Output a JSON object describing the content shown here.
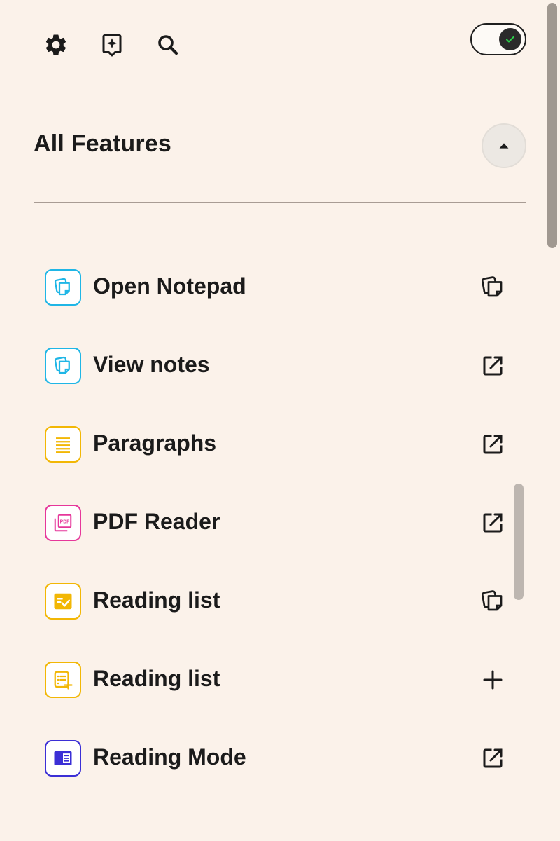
{
  "topbar": {
    "settings": "gear-icon",
    "ai_assistant": "sparkle-note-icon",
    "search": "search-icon",
    "toggle_on": true
  },
  "section": {
    "title": "All Features",
    "collapsed": false
  },
  "items": [
    {
      "label": "Open Notepad",
      "icon": "notepad-icon",
      "color": "#1FB6E6",
      "action": "copy-note-icon"
    },
    {
      "label": "View notes",
      "icon": "notepad-icon",
      "color": "#1FB6E6",
      "action": "external-link-icon"
    },
    {
      "label": "Paragraphs",
      "icon": "paragraph-lines-icon",
      "color": "#F2B705",
      "action": "external-link-icon"
    },
    {
      "label": "PDF Reader",
      "icon": "pdf-icon",
      "color": "#E6379A",
      "action": "external-link-icon"
    },
    {
      "label": "Reading list",
      "icon": "checklist-icon",
      "color": "#F2B705",
      "action": "copy-note-icon"
    },
    {
      "label": "Reading list",
      "icon": "list-add-icon",
      "color": "#F2B705",
      "action": "plus-icon"
    },
    {
      "label": "Reading Mode",
      "icon": "reading-mode-icon",
      "color": "#3B2FD6",
      "action": "external-link-icon"
    }
  ],
  "icon_pdf_text": "PDF",
  "colors": {
    "background": "#FBF2EA",
    "toggle_check": "#2BD14A"
  }
}
